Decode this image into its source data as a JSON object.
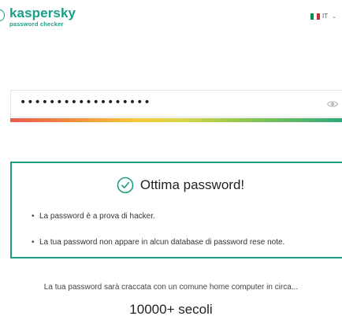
{
  "brand": {
    "name": "kaspersky",
    "subtitle": "password checker",
    "color": "#1a9e84"
  },
  "language": {
    "code": "IT",
    "flag": [
      "#009246",
      "#ffffff",
      "#ce2b37"
    ],
    "icon": "chevron-down-icon"
  },
  "password": {
    "masked_value": "••••••••••••••••••",
    "toggle_icon": "eye-icon"
  },
  "strength": {
    "gradient": [
      "#e85a4f",
      "#f5c93a",
      "#2ea87c"
    ],
    "level": 1.0
  },
  "result": {
    "icon": "check-circle-icon",
    "title": "Ottima password!",
    "items": [
      "La password è a prova di hacker.",
      "La tua password non appare in alcun database di password rese note."
    ],
    "accent": "#1a9e84"
  },
  "crack": {
    "note": "La tua password sarà craccata con un comune home computer in circa...",
    "time": "10000+ secoli"
  }
}
